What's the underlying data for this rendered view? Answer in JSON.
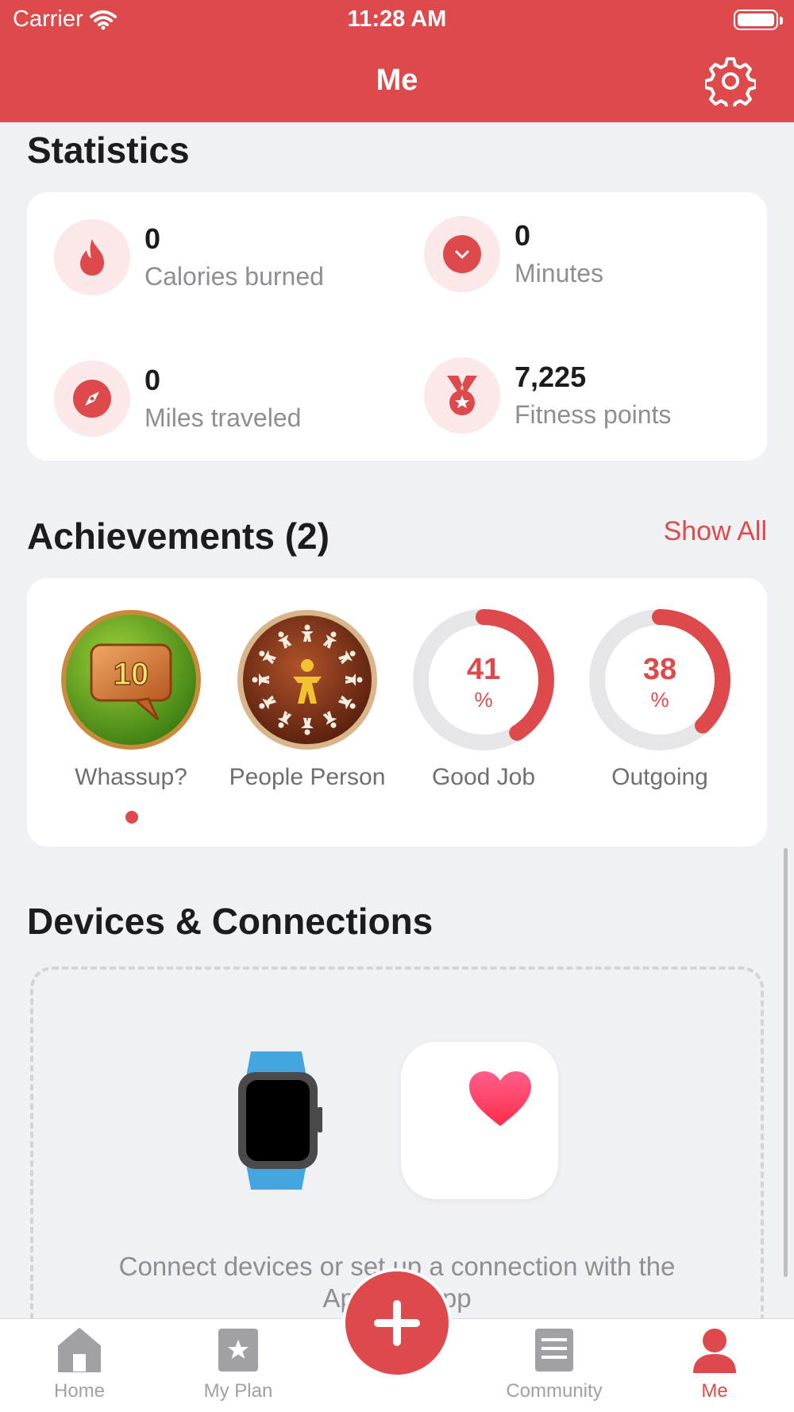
{
  "status_bar": {
    "carrier": "Carrier",
    "time": "11:28 AM"
  },
  "header": {
    "title": "Me"
  },
  "statistics": {
    "title": "Statistics",
    "items": [
      {
        "value": "0",
        "label": "Calories burned",
        "icon": "flame-icon"
      },
      {
        "value": "0",
        "label": "Minutes",
        "icon": "clock-icon"
      },
      {
        "value": "0",
        "label": "Miles traveled",
        "icon": "compass-icon"
      },
      {
        "value": "7,225",
        "label": "Fitness points",
        "icon": "medal-icon"
      }
    ]
  },
  "achievements": {
    "title": "Achievements (2)",
    "show_all": "Show All",
    "items": [
      {
        "name": "Whassup?",
        "badge_text": "10",
        "new": true
      },
      {
        "name": "People Person"
      },
      {
        "name": "Good Job",
        "progress": "41",
        "unit": "%"
      },
      {
        "name": "Outgoing",
        "progress": "38",
        "unit": "%"
      }
    ]
  },
  "devices": {
    "title": "Devices & Connections",
    "text_line1": "Connect devices or set up a connection with the",
    "text_line2": "App        app"
  },
  "tabbar": {
    "items": [
      {
        "label": "Home",
        "icon": "home-icon"
      },
      {
        "label": "My Plan",
        "icon": "star-icon"
      },
      {
        "label": "Community",
        "icon": "document-icon"
      },
      {
        "label": "Me",
        "icon": "person-icon",
        "active": true
      }
    ]
  },
  "colors": {
    "accent": "#de4a4b",
    "background": "#f0f1f5"
  }
}
